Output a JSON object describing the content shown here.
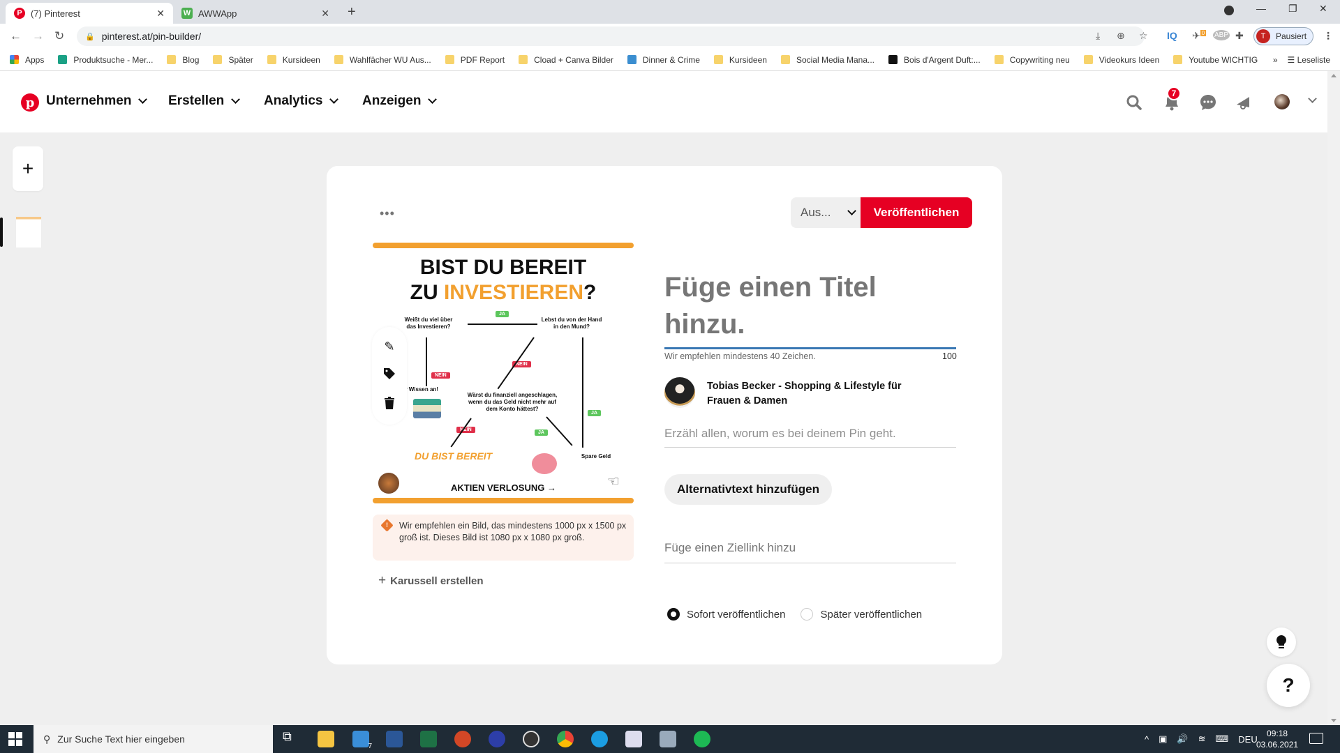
{
  "browser": {
    "tabs": [
      {
        "title": "(7) Pinterest",
        "active": true,
        "favicon": "pinterest-logo"
      },
      {
        "title": "AWWApp",
        "active": false,
        "favicon": "awwapp-logo"
      }
    ],
    "new_tab_label": "+",
    "url": "pinterest.at/pin-builder/",
    "profile_initial": "T",
    "profile_status": "Pausiert",
    "extension_badge": "0",
    "bookmarks": [
      {
        "label": "Apps",
        "icon": "apps-grid-icon"
      },
      {
        "label": "Produktsuche - Mer...",
        "icon": "shirt-icon"
      },
      {
        "label": "Blog",
        "icon": "folder-icon"
      },
      {
        "label": "Später",
        "icon": "folder-icon"
      },
      {
        "label": "Kursideen",
        "icon": "folder-icon"
      },
      {
        "label": "Wahlfächer WU Aus...",
        "icon": "folder-icon"
      },
      {
        "label": "PDF Report",
        "icon": "folder-icon"
      },
      {
        "label": "Cload + Canva Bilder",
        "icon": "folder-icon"
      },
      {
        "label": "Dinner & Crime",
        "icon": "site-icon"
      },
      {
        "label": "Kursideen",
        "icon": "folder-icon"
      },
      {
        "label": "Social Media Mana...",
        "icon": "folder-icon"
      },
      {
        "label": "Bois d'Argent Duft:...",
        "icon": "site-icon"
      },
      {
        "label": "Copywriting neu",
        "icon": "folder-icon"
      },
      {
        "label": "Videokurs Ideen",
        "icon": "folder-icon"
      },
      {
        "label": "Youtube WICHTIG",
        "icon": "folder-icon"
      }
    ],
    "bookmarks_overflow": "»",
    "reading_list": "Leseliste"
  },
  "pinterest_nav": {
    "menus": [
      "Unternehmen",
      "Erstellen",
      "Analytics",
      "Anzeigen"
    ],
    "notification_count": "7"
  },
  "sidebar": {
    "add_label": "+"
  },
  "pin_builder": {
    "more_label": "•••",
    "board_select": "Aus...",
    "publish_label": "Veröffentlichen",
    "image": {
      "headline_1": "BIST DU BEREIT",
      "headline_2a": "ZU ",
      "headline_2b": "INVESTIEREN",
      "headline_2c": "?",
      "q1": "Weißt du viel über das Investieren?",
      "q2": "Lebst du von der Hand in den Mund?",
      "q3": "Wärst du finanziell angeschlagen, wenn du das Geld nicht mehr auf dem Konto hättest?",
      "a1": "...e dir Wissen an!",
      "ready": "DU BIST BEREIT",
      "save": "Spare Geld",
      "footer": "AKTIEN VERLOSUNG →",
      "ja": "JA",
      "nein": "NEIN"
    },
    "warning": "Wir empfehlen ein Bild, das mindestens 1000 px x 1500 px groß ist. Dieses Bild ist 1080 px x 1080 px groß.",
    "carousel_label": "Karussell erstellen",
    "title_placeholder": "Füge einen Titel hinzu.",
    "title_hint": "Wir empfehlen mindestens 40 Zeichen.",
    "title_remaining": "100",
    "author": "Tobias Becker - Shopping & Lifestyle für Frauen & Damen",
    "description_placeholder": "Erzähl allen, worum es bei deinem Pin geht.",
    "alt_text_label": "Alternativtext hinzufügen",
    "link_placeholder": "Füge einen Ziellink hinzu",
    "publish_options": [
      {
        "label": "Sofort veröffentlichen",
        "selected": true
      },
      {
        "label": "Später veröffentlichen",
        "selected": false
      }
    ]
  },
  "help": {
    "bulb_icon": "lightbulb-icon",
    "help_label": "?"
  },
  "taskbar": {
    "search_placeholder": "Zur Suche Text hier eingeben",
    "mail_badge": "7",
    "language": "DEU",
    "time": "09:18",
    "date": "03.06.2021"
  },
  "colors": {
    "pinterest_red": "#e60023",
    "title_underline": "#3a78b4",
    "warning_bg": "#fdf1ec",
    "accent_orange": "#f2a02f"
  }
}
